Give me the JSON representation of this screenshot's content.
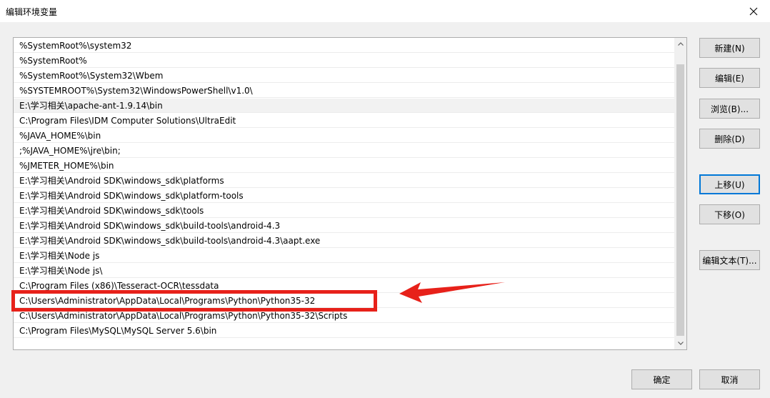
{
  "window": {
    "title": "编辑环境变量"
  },
  "list": {
    "items": [
      "%SystemRoot%\\system32",
      "%SystemRoot%",
      "%SystemRoot%\\System32\\Wbem",
      "%SYSTEMROOT%\\System32\\WindowsPowerShell\\v1.0\\",
      "E:\\学习相关\\apache-ant-1.9.14\\bin",
      "C:\\Program Files\\IDM Computer Solutions\\UltraEdit",
      "%JAVA_HOME%\\bin",
      ";%JAVA_HOME%\\jre\\bin;",
      "%JMETER_HOME%\\bin",
      "E:\\学习相关\\Android SDK\\windows_sdk\\platforms",
      "E:\\学习相关\\Android SDK\\windows_sdk\\platform-tools",
      "E:\\学习相关\\Android SDK\\windows_sdk\\tools",
      "E:\\学习相关\\Android SDK\\windows_sdk\\build-tools\\android-4.3",
      "E:\\学习相关\\Android SDK\\windows_sdk\\build-tools\\android-4.3\\aapt.exe",
      "E:\\学习相关\\Node js",
      "E:\\学习相关\\Node js\\",
      "C:\\Program Files (x86)\\Tesseract-OCR\\tessdata",
      "C:\\Users\\Administrator\\AppData\\Local\\Programs\\Python\\Python35-32",
      "C:\\Users\\Administrator\\AppData\\Local\\Programs\\Python\\Python35-32\\Scripts",
      "C:\\Program Files\\MySQL\\MySQL Server 5.6\\bin"
    ],
    "hovered_index": 4,
    "annotated_index": 17
  },
  "buttons": {
    "new": "新建(N)",
    "edit": "编辑(E)",
    "browse": "浏览(B)...",
    "delete": "删除(D)",
    "move_up": "上移(U)",
    "move_down": "下移(O)",
    "edit_text": "编辑文本(T)...",
    "ok": "确定",
    "cancel": "取消"
  },
  "colors": {
    "annotation": "#e7211a",
    "focus": "#0078d7",
    "hover_row": "#e5f3ff"
  }
}
